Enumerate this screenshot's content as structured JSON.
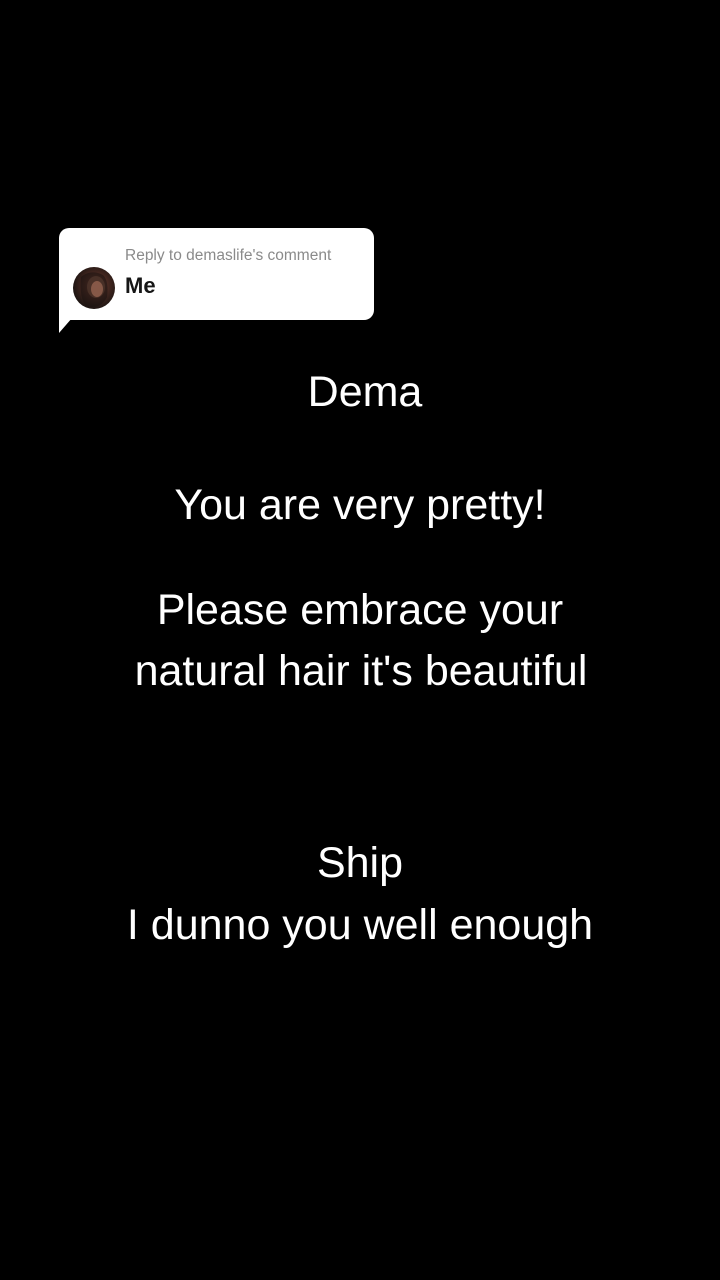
{
  "reply": {
    "header": "Reply to demaslife's comment",
    "comment_text": "Me",
    "avatar_icon": "profile-photo-avatar"
  },
  "captions": {
    "line1": "Dema",
    "line2": "You are very pretty!",
    "line3a": "Please embrace your",
    "line3b": "natural hair it's beautiful",
    "line4": "Ship",
    "line5": "I dunno you well enough"
  },
  "colors": {
    "background": "#000000",
    "caption_text": "#ffffff",
    "reply_card": "#ffffff",
    "reply_header_text": "#8a8a8a",
    "reply_comment_text": "#161616"
  }
}
